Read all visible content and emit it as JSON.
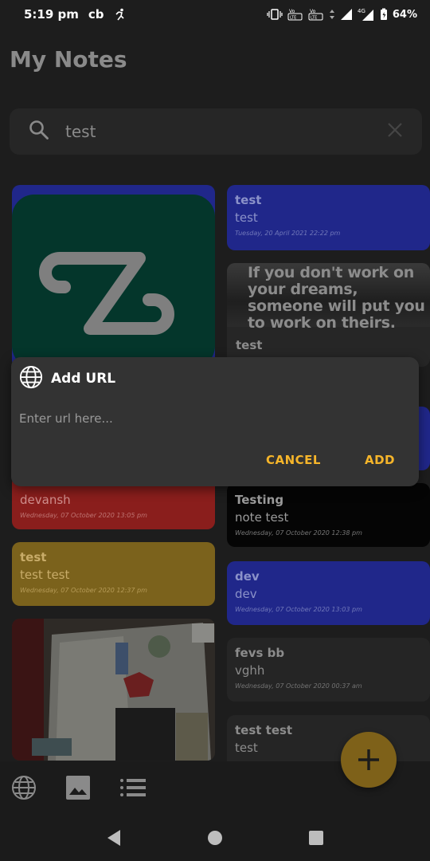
{
  "status_bar": {
    "time": "5:19 pm",
    "carrier_badge": "cb",
    "network": "4G",
    "battery": "64%"
  },
  "app": {
    "title": "My Notes"
  },
  "search": {
    "query": "test"
  },
  "notes": {
    "n1": {
      "title": "test",
      "subtitle": "test",
      "date": "Tuesday, 20 April 2021 22:22 pm"
    },
    "n2": {
      "quote": "If you don't work on your dreams, someone will put you to work on theirs.",
      "title": "test"
    },
    "n3": {
      "title": "devansh",
      "date": "Wednesday, 07 October 2020 13:05 pm"
    },
    "n4": {
      "title": "Testing",
      "subtitle": "note test",
      "date": "Wednesday, 07 October 2020 12:38 pm"
    },
    "n5": {
      "title": "test",
      "subtitle": "test test",
      "date": "Wednesday, 07 October 2020 12:37 pm"
    },
    "n6": {
      "title": "dev",
      "subtitle": "dev",
      "date": "Wednesday, 07 October 2020 13:03 pm"
    },
    "n7": {
      "title": "fevs bb",
      "subtitle": "vghh",
      "date": "Wednesday, 07 October 2020 00:37 am"
    },
    "n8": {
      "title": "test test",
      "subtitle": "test"
    }
  },
  "dialog": {
    "title": "Add URL",
    "placeholder": "Enter url here...",
    "cancel_label": "CANCEL",
    "add_label": "ADD"
  },
  "colors": {
    "accent": "#f6b52a",
    "blue_note": "#20278a",
    "red_note": "#8a1e1c",
    "gold_note": "#7b621c",
    "black_note": "#050505"
  }
}
